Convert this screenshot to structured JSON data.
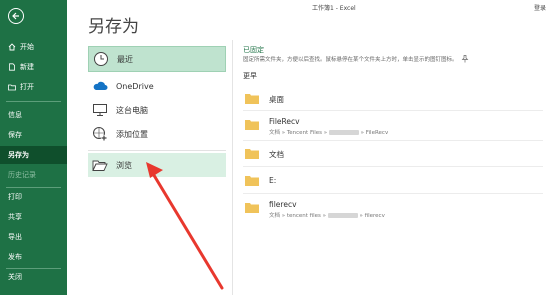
{
  "window": {
    "title": "工作簿1 - Excel",
    "signin": "登录"
  },
  "sidebar": {
    "items": [
      {
        "label": "开始",
        "icon": "home-icon"
      },
      {
        "label": "新建",
        "icon": "new-file-icon"
      },
      {
        "label": "打开",
        "icon": "open-folder-icon"
      },
      {
        "label": "信息"
      },
      {
        "label": "保存"
      },
      {
        "label": "另存为"
      },
      {
        "label": "历史记录"
      },
      {
        "label": "打印"
      },
      {
        "label": "共享"
      },
      {
        "label": "导出"
      },
      {
        "label": "发布"
      },
      {
        "label": "关闭"
      }
    ]
  },
  "page": {
    "title": "另存为"
  },
  "locations": [
    {
      "label": "最近",
      "icon": "clock-icon"
    },
    {
      "label": "OneDrive",
      "icon": "cloud-icon"
    },
    {
      "label": "这台电脑",
      "icon": "computer-icon"
    },
    {
      "label": "添加位置",
      "icon": "add-location-icon"
    },
    {
      "label": "浏览",
      "icon": "folder-open-icon"
    }
  ],
  "pinned": {
    "title": "已固定",
    "hint": "固定所需文件夹，方便以后查找。鼠标悬停在某个文件夹上方时，单击显示的图钉图标。"
  },
  "earlier": {
    "title": "更早",
    "folders": [
      {
        "name": "桌面",
        "path": ""
      },
      {
        "name": "FileRecv",
        "path_start": "文档 » Tencent Files » ",
        "path_end": " » FileRecv"
      },
      {
        "name": "文档",
        "path": ""
      },
      {
        "name": "E:",
        "path": ""
      },
      {
        "name": "filerecv",
        "path_start": "文档 » tencent files » ",
        "path_end": " » filerecv"
      }
    ]
  },
  "colors": {
    "sidebar_bg": "#1e7145",
    "sidebar_active": "#0f4f2c",
    "selected_bg": "#bfe3cf",
    "folder_yellow": "#f0c35a",
    "arrow_red": "#e8382e"
  }
}
